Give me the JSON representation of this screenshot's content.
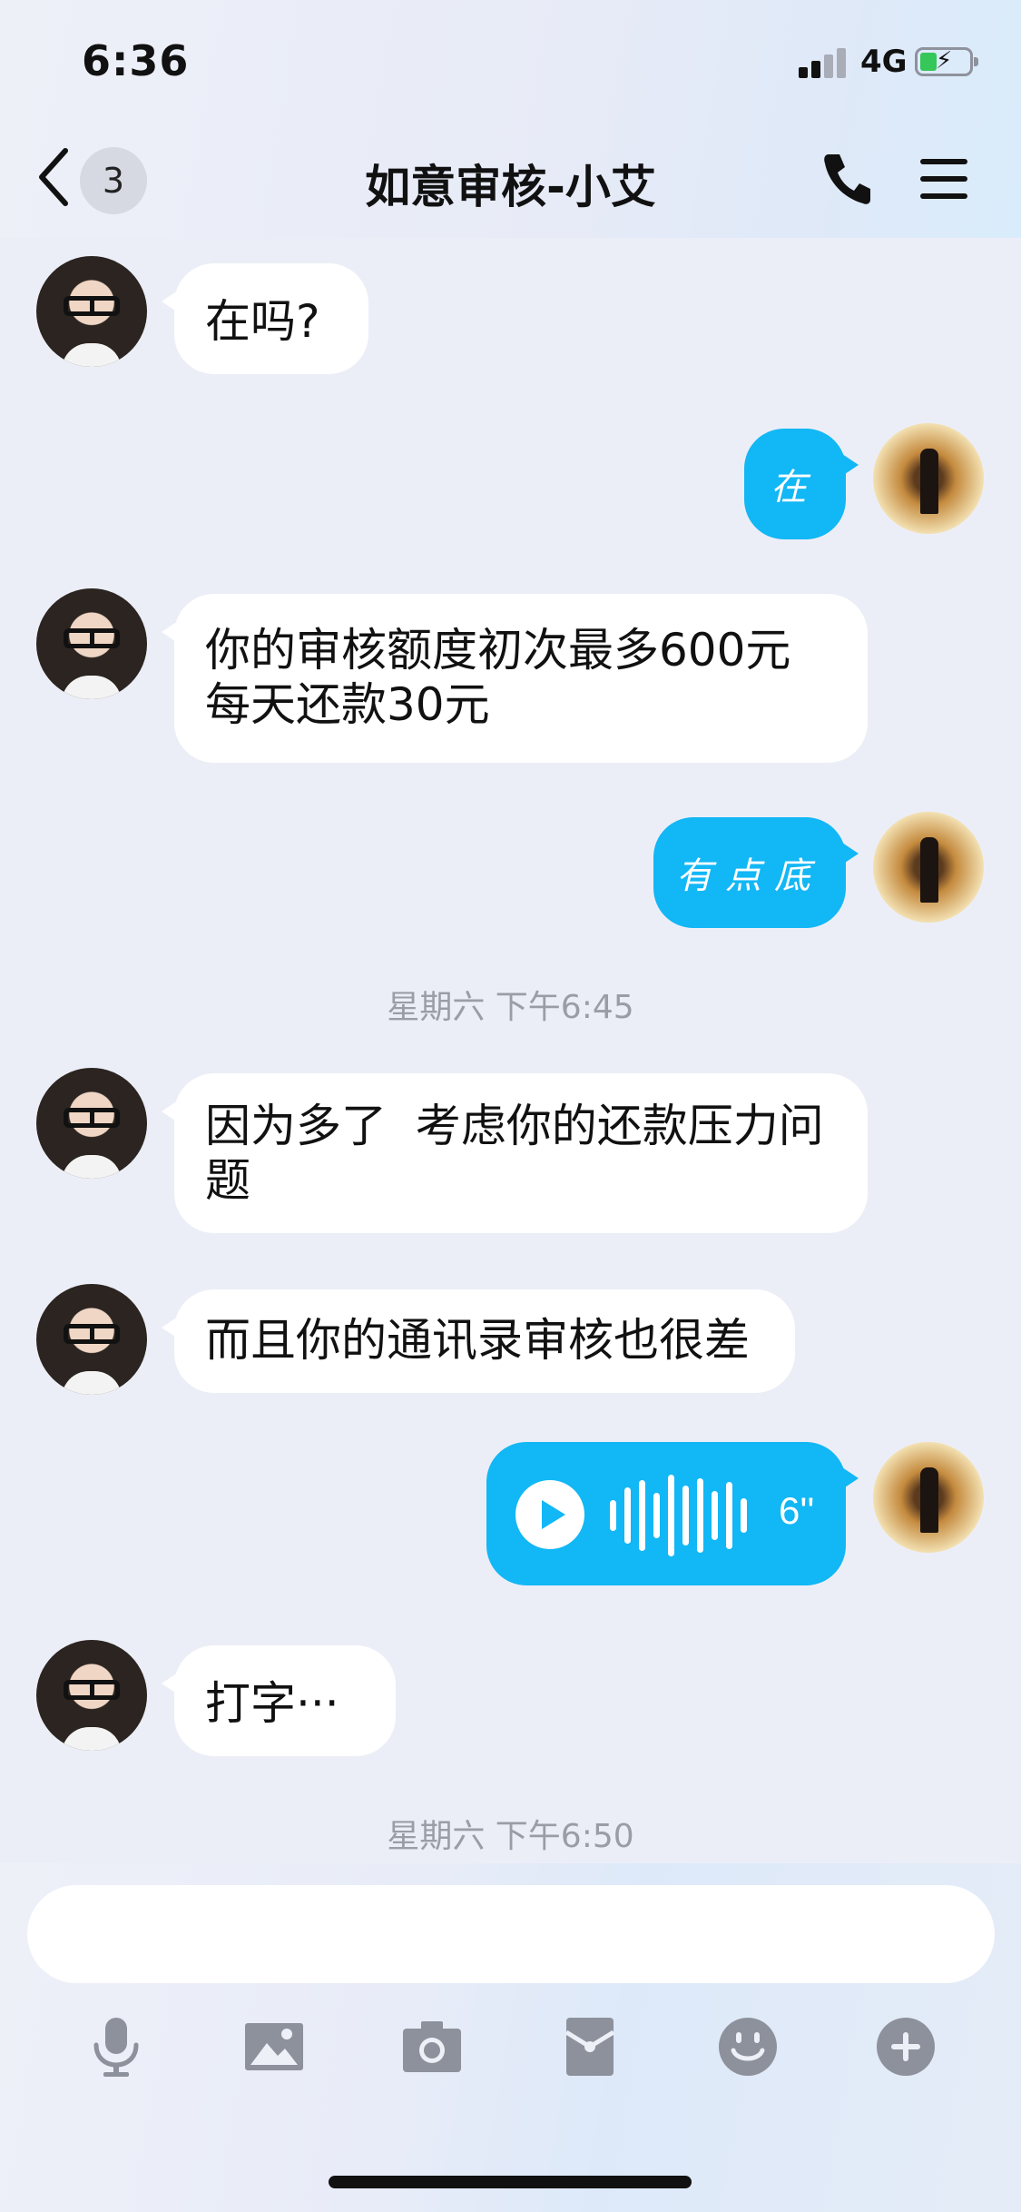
{
  "status_bar": {
    "time": "6:36",
    "network": "4G"
  },
  "nav": {
    "back_badge": "3",
    "title": "如意审核-小艾"
  },
  "messages": [
    {
      "side": "left",
      "text": "在吗?"
    },
    {
      "side": "right",
      "text": "在"
    },
    {
      "side": "left",
      "text_line1": "你的审核额度初次最多600元",
      "text_line2": "每天还款30元"
    },
    {
      "side": "right",
      "text": "有点底"
    },
    {
      "type": "timestamp",
      "text": "星期六 下午6:45"
    },
    {
      "side": "left",
      "text_line1": "因为多了  考虑你的还款压力问",
      "text_line2": "题"
    },
    {
      "side": "left",
      "text": "而且你的通讯录审核也很差"
    },
    {
      "side": "right",
      "type": "voice",
      "duration": "6''"
    },
    {
      "side": "left",
      "text": "打字···"
    },
    {
      "type": "timestamp",
      "text": "星期六 下午6:50"
    }
  ],
  "input": {
    "placeholder": ""
  },
  "toolbar": [
    "microphone-icon",
    "image-icon",
    "camera-icon",
    "red-packet-icon",
    "emoji-icon",
    "plus-icon"
  ],
  "colors": {
    "accent": "#12b7f5",
    "background": "#eceef7",
    "icon_gray": "#8d919b"
  }
}
